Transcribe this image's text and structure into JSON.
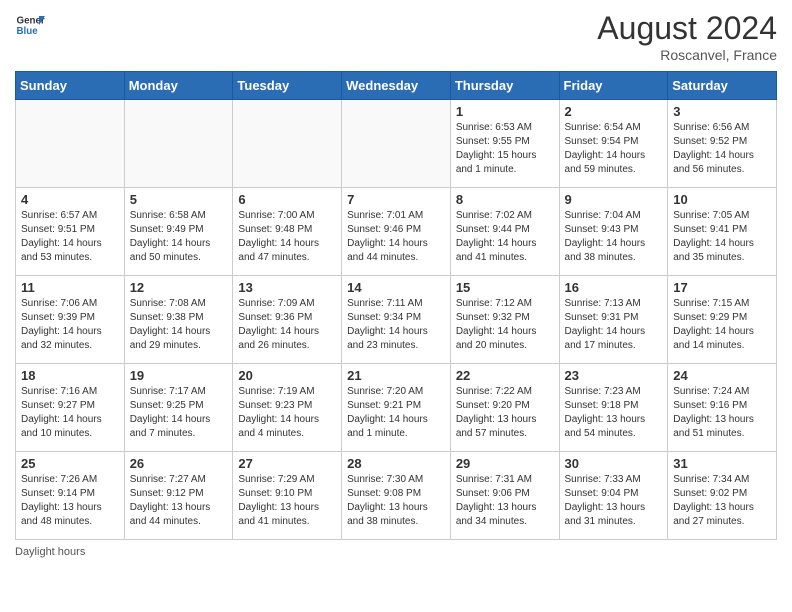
{
  "header": {
    "logo_general": "General",
    "logo_blue": "Blue",
    "month_year": "August 2024",
    "location": "Roscanvel, France"
  },
  "days_of_week": [
    "Sunday",
    "Monday",
    "Tuesday",
    "Wednesday",
    "Thursday",
    "Friday",
    "Saturday"
  ],
  "weeks": [
    [
      {
        "day": "",
        "info": ""
      },
      {
        "day": "",
        "info": ""
      },
      {
        "day": "",
        "info": ""
      },
      {
        "day": "",
        "info": ""
      },
      {
        "day": "1",
        "info": "Sunrise: 6:53 AM\nSunset: 9:55 PM\nDaylight: 15 hours\nand 1 minute."
      },
      {
        "day": "2",
        "info": "Sunrise: 6:54 AM\nSunset: 9:54 PM\nDaylight: 14 hours\nand 59 minutes."
      },
      {
        "day": "3",
        "info": "Sunrise: 6:56 AM\nSunset: 9:52 PM\nDaylight: 14 hours\nand 56 minutes."
      }
    ],
    [
      {
        "day": "4",
        "info": "Sunrise: 6:57 AM\nSunset: 9:51 PM\nDaylight: 14 hours\nand 53 minutes."
      },
      {
        "day": "5",
        "info": "Sunrise: 6:58 AM\nSunset: 9:49 PM\nDaylight: 14 hours\nand 50 minutes."
      },
      {
        "day": "6",
        "info": "Sunrise: 7:00 AM\nSunset: 9:48 PM\nDaylight: 14 hours\nand 47 minutes."
      },
      {
        "day": "7",
        "info": "Sunrise: 7:01 AM\nSunset: 9:46 PM\nDaylight: 14 hours\nand 44 minutes."
      },
      {
        "day": "8",
        "info": "Sunrise: 7:02 AM\nSunset: 9:44 PM\nDaylight: 14 hours\nand 41 minutes."
      },
      {
        "day": "9",
        "info": "Sunrise: 7:04 AM\nSunset: 9:43 PM\nDaylight: 14 hours\nand 38 minutes."
      },
      {
        "day": "10",
        "info": "Sunrise: 7:05 AM\nSunset: 9:41 PM\nDaylight: 14 hours\nand 35 minutes."
      }
    ],
    [
      {
        "day": "11",
        "info": "Sunrise: 7:06 AM\nSunset: 9:39 PM\nDaylight: 14 hours\nand 32 minutes."
      },
      {
        "day": "12",
        "info": "Sunrise: 7:08 AM\nSunset: 9:38 PM\nDaylight: 14 hours\nand 29 minutes."
      },
      {
        "day": "13",
        "info": "Sunrise: 7:09 AM\nSunset: 9:36 PM\nDaylight: 14 hours\nand 26 minutes."
      },
      {
        "day": "14",
        "info": "Sunrise: 7:11 AM\nSunset: 9:34 PM\nDaylight: 14 hours\nand 23 minutes."
      },
      {
        "day": "15",
        "info": "Sunrise: 7:12 AM\nSunset: 9:32 PM\nDaylight: 14 hours\nand 20 minutes."
      },
      {
        "day": "16",
        "info": "Sunrise: 7:13 AM\nSunset: 9:31 PM\nDaylight: 14 hours\nand 17 minutes."
      },
      {
        "day": "17",
        "info": "Sunrise: 7:15 AM\nSunset: 9:29 PM\nDaylight: 14 hours\nand 14 minutes."
      }
    ],
    [
      {
        "day": "18",
        "info": "Sunrise: 7:16 AM\nSunset: 9:27 PM\nDaylight: 14 hours\nand 10 minutes."
      },
      {
        "day": "19",
        "info": "Sunrise: 7:17 AM\nSunset: 9:25 PM\nDaylight: 14 hours\nand 7 minutes."
      },
      {
        "day": "20",
        "info": "Sunrise: 7:19 AM\nSunset: 9:23 PM\nDaylight: 14 hours\nand 4 minutes."
      },
      {
        "day": "21",
        "info": "Sunrise: 7:20 AM\nSunset: 9:21 PM\nDaylight: 14 hours\nand 1 minute."
      },
      {
        "day": "22",
        "info": "Sunrise: 7:22 AM\nSunset: 9:20 PM\nDaylight: 13 hours\nand 57 minutes."
      },
      {
        "day": "23",
        "info": "Sunrise: 7:23 AM\nSunset: 9:18 PM\nDaylight: 13 hours\nand 54 minutes."
      },
      {
        "day": "24",
        "info": "Sunrise: 7:24 AM\nSunset: 9:16 PM\nDaylight: 13 hours\nand 51 minutes."
      }
    ],
    [
      {
        "day": "25",
        "info": "Sunrise: 7:26 AM\nSunset: 9:14 PM\nDaylight: 13 hours\nand 48 minutes."
      },
      {
        "day": "26",
        "info": "Sunrise: 7:27 AM\nSunset: 9:12 PM\nDaylight: 13 hours\nand 44 minutes."
      },
      {
        "day": "27",
        "info": "Sunrise: 7:29 AM\nSunset: 9:10 PM\nDaylight: 13 hours\nand 41 minutes."
      },
      {
        "day": "28",
        "info": "Sunrise: 7:30 AM\nSunset: 9:08 PM\nDaylight: 13 hours\nand 38 minutes."
      },
      {
        "day": "29",
        "info": "Sunrise: 7:31 AM\nSunset: 9:06 PM\nDaylight: 13 hours\nand 34 minutes."
      },
      {
        "day": "30",
        "info": "Sunrise: 7:33 AM\nSunset: 9:04 PM\nDaylight: 13 hours\nand 31 minutes."
      },
      {
        "day": "31",
        "info": "Sunrise: 7:34 AM\nSunset: 9:02 PM\nDaylight: 13 hours\nand 27 minutes."
      }
    ]
  ],
  "footer": {
    "note": "Daylight hours"
  }
}
